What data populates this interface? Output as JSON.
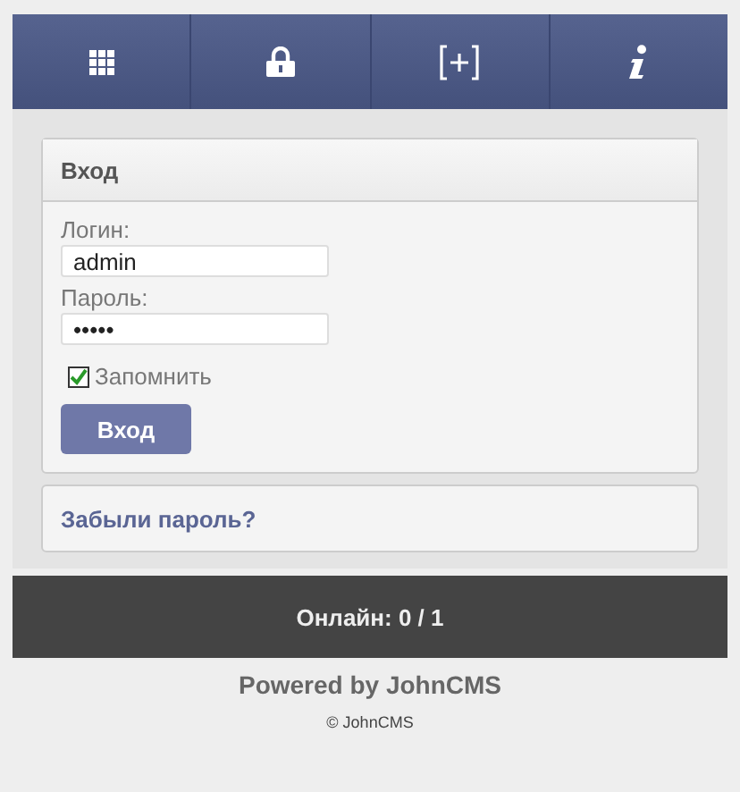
{
  "nav": [
    {
      "kind": "grid"
    },
    {
      "kind": "lock"
    },
    {
      "kind": "register"
    },
    {
      "kind": "info"
    }
  ],
  "login": {
    "title": "Вход",
    "login_label": "Логин:",
    "login_value": "admin",
    "password_label": "Пароль:",
    "password_value": "•••••",
    "remember": {
      "label": "Запомнить",
      "checked": true
    },
    "submit": "Вход"
  },
  "forgot_link": "Забыли пароль?",
  "online": "Онлайн: 0 / 1",
  "powered": "Powered by JohnCMS",
  "copyright": "© JohnCMS"
}
